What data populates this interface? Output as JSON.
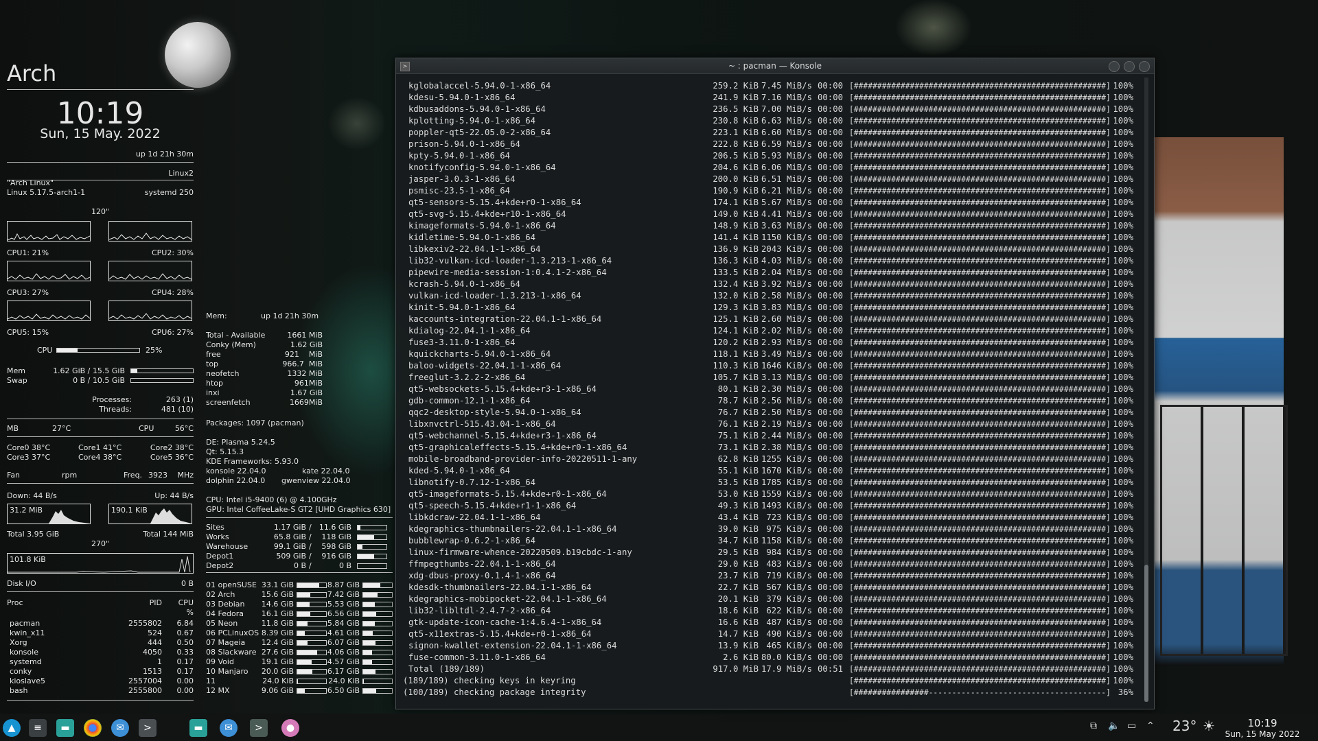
{
  "conky": {
    "title": "Arch",
    "time": "10:19",
    "date": "Sun, 15 May. 2022",
    "uptime": "up  1d 21h 30m",
    "kernel_name": "Linux2",
    "os": "\"Arch Linux\"",
    "kernel": "Linux 5.17.5-arch1-1",
    "systemd": "systemd 250",
    "graph_interval": "120\"",
    "cpus": [
      "CPU1: 21%",
      "CPU2: 30%",
      "CPU3: 27%",
      "CPU4: 28%",
      "CPU5: 15%",
      "CPU6: 27%"
    ],
    "cpu_label": "CPU",
    "cpu_total": "25%",
    "cpu_total_frac": 0.25,
    "mem_label": "Mem",
    "mem_value": "1.62 GiB / 15.5 GiB",
    "mem_frac": 0.1,
    "swap_label": "Swap",
    "swap_value": "0 B / 10.5 GiB",
    "swap_frac": 0,
    "processes_label": "Processes:",
    "processes_value": "263 (1)",
    "threads_label": "Threads:",
    "threads_value": "481 (10)",
    "mb_label": "MB",
    "mb_temp": "27°C",
    "cpu_temp_label": "CPU",
    "cpu_temp": "56°C",
    "cores": [
      "Core0  38°C",
      "Core1  41°C",
      "Core2  38°C",
      "Core3  37°C",
      "Core4  38°C",
      "Core5  36°C"
    ],
    "fan_label": "Fan",
    "fan_unit": "rpm",
    "freq_label": "Freq.",
    "freq_value": "3923",
    "freq_unit": "MHz",
    "down": "Down: 44 B/s",
    "up": "Up: 44 B/s",
    "down_graph": "31.2 MiB",
    "up_graph": "190.1 KiB",
    "total_down": "Total 3.95 GiB",
    "total_up": "Total 144 MiB",
    "graph_interval2": "270\"",
    "disk_graph": "101.8 KiB",
    "disk_io_label": "Disk I/O",
    "disk_io_value": "0 B",
    "proc_header": {
      "name": "Proc",
      "pid": "PID",
      "cpu": "CPU",
      "unit": "%"
    },
    "procs": [
      {
        "name": "pacman",
        "pid": "2555802",
        "cpu": "6.84"
      },
      {
        "name": "kwin_x11",
        "pid": "524",
        "cpu": "0.67"
      },
      {
        "name": "Xorg",
        "pid": "444",
        "cpu": "0.50"
      },
      {
        "name": "konsole",
        "pid": "4050",
        "cpu": "0.33"
      },
      {
        "name": "systemd",
        "pid": "1",
        "cpu": "0.17"
      },
      {
        "name": "conky",
        "pid": "1513",
        "cpu": "0.17"
      },
      {
        "name": "kioslave5",
        "pid": "2557004",
        "cpu": "0.00"
      },
      {
        "name": "bash",
        "pid": "2555800",
        "cpu": "0.00"
      }
    ]
  },
  "conky2": {
    "mem_header": "Mem:",
    "uptime": "up  1d 21h 30m",
    "mem_rows": [
      {
        "k": "Total - Available",
        "v": "1661 MiB"
      },
      {
        "k": "Conky (Mem)",
        "v": "1.62 GiB"
      },
      {
        "k": "free",
        "v": "921    MiB"
      },
      {
        "k": "top",
        "v": "966.7  MiB"
      },
      {
        "k": "neofetch",
        "v": "1332 MiB"
      },
      {
        "k": "htop",
        "v": "961MiB"
      },
      {
        "k": "inxi",
        "v": "1.67 GiB"
      },
      {
        "k": "screenfetch",
        "v": "1669MiB"
      }
    ],
    "packages": "Packages: 1097 (pacman)",
    "de": "DE: Plasma 5.24.5",
    "qt": "Qt: 5.15.3",
    "kf": "KDE Frameworks: 5.93.0",
    "konsole": "konsole 22.04.0",
    "kate": "kate 22.04.0",
    "dolphin": "dolphin 22.04.0",
    "gwenview": "gwenview 22.04.0",
    "cpu": "CPU: Intel i5-9400 (6) @ 4.100GHz",
    "gpu": "GPU: Intel CoffeeLake-S GT2 [UHD Graphics 630]",
    "mounts": [
      {
        "name": "Sites",
        "used": "1.17 GiB",
        "size": "11.6 GiB",
        "frac": 0.1
      },
      {
        "name": "Works",
        "used": "65.8 GiB",
        "size": "118 GiB",
        "frac": 0.56
      },
      {
        "name": "Warehouse",
        "used": "99.1 GiB",
        "size": "598 GiB",
        "frac": 0.17
      },
      {
        "name": "Depot1",
        "used": "509 GiB",
        "size": "916 GiB",
        "frac": 0.56
      },
      {
        "name": "Depot2",
        "used": "0 B",
        "size": "0 B",
        "frac": 0
      }
    ],
    "distros": [
      {
        "name": "01 openSUSE",
        "a": "33.1 GiB",
        "af": 0.75,
        "b": "8.87 GiB",
        "bf": 0.6
      },
      {
        "name": "02 Arch",
        "a": "15.6 GiB",
        "af": 0.45,
        "b": "7.42 GiB",
        "bf": 0.5
      },
      {
        "name": "03 Debian",
        "a": "14.6 GiB",
        "af": 0.42,
        "b": "5.53 GiB",
        "bf": 0.4
      },
      {
        "name": "04 Fedora",
        "a": "16.1 GiB",
        "af": 0.46,
        "b": "6.56 GiB",
        "bf": 0.45
      },
      {
        "name": "05 Neon",
        "a": "11.8 GiB",
        "af": 0.35,
        "b": "5.84 GiB",
        "bf": 0.4
      },
      {
        "name": "06 PCLinuxOS",
        "a": "8.39 GiB",
        "af": 0.25,
        "b": "4.61 GiB",
        "bf": 0.33
      },
      {
        "name": "07 Mageia",
        "a": "12.4 GiB",
        "af": 0.36,
        "b": "6.07 GiB",
        "bf": 0.42
      },
      {
        "name": "08 Slackware",
        "a": "27.6 GiB",
        "af": 0.7,
        "b": "4.06 GiB",
        "bf": 0.3
      },
      {
        "name": "09 Void",
        "a": "19.1 GiB",
        "af": 0.5,
        "b": "4.57 GiB",
        "bf": 0.32
      },
      {
        "name": "10 Manjaro",
        "a": "20.0 GiB",
        "af": 0.52,
        "b": "6.17 GiB",
        "bf": 0.43
      },
      {
        "name": "11",
        "a": "24.0 KiB",
        "af": 0.02,
        "b": "24.0 KiB",
        "bf": 0.02
      },
      {
        "name": "12 MX",
        "a": "9.06 GiB",
        "af": 0.27,
        "b": "6.50 GiB",
        "bf": 0.45
      }
    ]
  },
  "konsole": {
    "title": "~ : pacman — Konsole",
    "rows": [
      [
        "kglobalaccel-5.94.0-1-x86_64",
        "259.2 KiB",
        "7.45 MiB/s",
        "00:00",
        "[######################################################]",
        "100%"
      ],
      [
        "kdesu-5.94.0-1-x86_64",
        "241.9 KiB",
        "7.16 MiB/s",
        "00:00",
        "[######################################################]",
        "100%"
      ],
      [
        "kdbusaddons-5.94.0-1-x86_64",
        "236.5 KiB",
        "7.00 MiB/s",
        "00:00",
        "[######################################################]",
        "100%"
      ],
      [
        "kplotting-5.94.0-1-x86_64",
        "230.8 KiB",
        "6.63 MiB/s",
        "00:00",
        "[######################################################]",
        "100%"
      ],
      [
        "poppler-qt5-22.05.0-2-x86_64",
        "223.1 KiB",
        "6.60 MiB/s",
        "00:00",
        "[######################################################]",
        "100%"
      ],
      [
        "prison-5.94.0-1-x86_64",
        "222.8 KiB",
        "6.59 MiB/s",
        "00:00",
        "[######################################################]",
        "100%"
      ],
      [
        "kpty-5.94.0-1-x86_64",
        "206.5 KiB",
        "5.93 MiB/s",
        "00:00",
        "[######################################################]",
        "100%"
      ],
      [
        "knotifyconfig-5.94.0-1-x86_64",
        "204.6 KiB",
        "6.06 MiB/s",
        "00:00",
        "[######################################################]",
        "100%"
      ],
      [
        "jasper-3.0.3-1-x86_64",
        "200.0 KiB",
        "6.51 MiB/s",
        "00:00",
        "[######################################################]",
        "100%"
      ],
      [
        "psmisc-23.5-1-x86_64",
        "190.9 KiB",
        "6.21 MiB/s",
        "00:00",
        "[######################################################]",
        "100%"
      ],
      [
        "qt5-sensors-5.15.4+kde+r0-1-x86_64",
        "174.1 KiB",
        "5.67 MiB/s",
        "00:00",
        "[######################################################]",
        "100%"
      ],
      [
        "qt5-svg-5.15.4+kde+r10-1-x86_64",
        "149.0 KiB",
        "4.41 MiB/s",
        "00:00",
        "[######################################################]",
        "100%"
      ],
      [
        "kimageformats-5.94.0-1-x86_64",
        "148.9 KiB",
        "3.63 MiB/s",
        "00:00",
        "[######################################################]",
        "100%"
      ],
      [
        "kidletime-5.94.0-1-x86_64",
        "141.4 KiB",
        "1150 KiB/s",
        "00:00",
        "[######################################################]",
        "100%"
      ],
      [
        "libkexiv2-22.04.1-1-x86_64",
        "136.9 KiB",
        "2043 KiB/s",
        "00:00",
        "[######################################################]",
        "100%"
      ],
      [
        "lib32-vulkan-icd-loader-1.3.213-1-x86_64",
        "136.3 KiB",
        "4.03 MiB/s",
        "00:00",
        "[######################################################]",
        "100%"
      ],
      [
        "pipewire-media-session-1:0.4.1-2-x86_64",
        "133.5 KiB",
        "2.04 MiB/s",
        "00:00",
        "[######################################################]",
        "100%"
      ],
      [
        "kcrash-5.94.0-1-x86_64",
        "132.4 KiB",
        "3.92 MiB/s",
        "00:00",
        "[######################################################]",
        "100%"
      ],
      [
        "vulkan-icd-loader-1.3.213-1-x86_64",
        "132.0 KiB",
        "2.58 MiB/s",
        "00:00",
        "[######################################################]",
        "100%"
      ],
      [
        "kinit-5.94.0-1-x86_64",
        "129.3 KiB",
        "3.83 MiB/s",
        "00:00",
        "[######################################################]",
        "100%"
      ],
      [
        "kaccounts-integration-22.04.1-1-x86_64",
        "125.1 KiB",
        "2.60 MiB/s",
        "00:00",
        "[######################################################]",
        "100%"
      ],
      [
        "kdialog-22.04.1-1-x86_64",
        "124.1 KiB",
        "2.02 MiB/s",
        "00:00",
        "[######################################################]",
        "100%"
      ],
      [
        "fuse3-3.11.0-1-x86_64",
        "120.2 KiB",
        "2.93 MiB/s",
        "00:00",
        "[######################################################]",
        "100%"
      ],
      [
        "kquickcharts-5.94.0-1-x86_64",
        "118.1 KiB",
        "3.49 MiB/s",
        "00:00",
        "[######################################################]",
        "100%"
      ],
      [
        "baloo-widgets-22.04.1-1-x86_64",
        "110.3 KiB",
        "1646 KiB/s",
        "00:00",
        "[######################################################]",
        "100%"
      ],
      [
        "freeglut-3.2.2-2-x86_64",
        "105.7 KiB",
        "3.13 MiB/s",
        "00:00",
        "[######################################################]",
        "100%"
      ],
      [
        "qt5-websockets-5.15.4+kde+r3-1-x86_64",
        "80.1 KiB",
        "2.30 MiB/s",
        "00:00",
        "[######################################################]",
        "100%"
      ],
      [
        "gdb-common-12.1-1-x86_64",
        "78.7 KiB",
        "2.56 MiB/s",
        "00:00",
        "[######################################################]",
        "100%"
      ],
      [
        "qqc2-desktop-style-5.94.0-1-x86_64",
        "76.7 KiB",
        "2.50 MiB/s",
        "00:00",
        "[######################################################]",
        "100%"
      ],
      [
        "libxnvctrl-515.43.04-1-x86_64",
        "76.1 KiB",
        "2.19 MiB/s",
        "00:00",
        "[######################################################]",
        "100%"
      ],
      [
        "qt5-webchannel-5.15.4+kde+r3-1-x86_64",
        "75.1 KiB",
        "2.44 MiB/s",
        "00:00",
        "[######################################################]",
        "100%"
      ],
      [
        "qt5-graphicaleffects-5.15.4+kde+r0-1-x86_64",
        "73.1 KiB",
        "2.38 MiB/s",
        "00:00",
        "[######################################################]",
        "100%"
      ],
      [
        "mobile-broadband-provider-info-20220511-1-any",
        "62.8 KiB",
        "1255 KiB/s",
        "00:00",
        "[######################################################]",
        "100%"
      ],
      [
        "kded-5.94.0-1-x86_64",
        "55.1 KiB",
        "1670 KiB/s",
        "00:00",
        "[######################################################]",
        "100%"
      ],
      [
        "libnotify-0.7.12-1-x86_64",
        "53.5 KiB",
        "1785 KiB/s",
        "00:00",
        "[######################################################]",
        "100%"
      ],
      [
        "qt5-imageformats-5.15.4+kde+r0-1-x86_64",
        "53.0 KiB",
        "1559 KiB/s",
        "00:00",
        "[######################################################]",
        "100%"
      ],
      [
        "qt5-speech-5.15.4+kde+r1-1-x86_64",
        "49.3 KiB",
        "1493 KiB/s",
        "00:00",
        "[######################################################]",
        "100%"
      ],
      [
        "libkdcraw-22.04.1-1-x86_64",
        "43.4 KiB",
        "723 KiB/s",
        "00:00",
        "[######################################################]",
        "100%"
      ],
      [
        "kdegraphics-thumbnailers-22.04.1-1-x86_64",
        "39.0 KiB",
        "975 KiB/s",
        "00:00",
        "[######################################################]",
        "100%"
      ],
      [
        "bubblewrap-0.6.2-1-x86_64",
        "34.7 KiB",
        "1158 KiB/s",
        "00:00",
        "[######################################################]",
        "100%"
      ],
      [
        "linux-firmware-whence-20220509.b19cbdc-1-any",
        "29.5 KiB",
        "984 KiB/s",
        "00:00",
        "[######################################################]",
        "100%"
      ],
      [
        "ffmpegthumbs-22.04.1-1-x86_64",
        "29.0 KiB",
        "483 KiB/s",
        "00:00",
        "[######################################################]",
        "100%"
      ],
      [
        "xdg-dbus-proxy-0.1.4-1-x86_64",
        "23.7 KiB",
        "719 KiB/s",
        "00:00",
        "[######################################################]",
        "100%"
      ],
      [
        "kdesdk-thumbnailers-22.04.1-1-x86_64",
        "22.7 KiB",
        "567 KiB/s",
        "00:00",
        "[######################################################]",
        "100%"
      ],
      [
        "kdegraphics-mobipocket-22.04.1-1-x86_64",
        "20.1 KiB",
        "379 KiB/s",
        "00:00",
        "[######################################################]",
        "100%"
      ],
      [
        "lib32-libltdl-2.4.7-2-x86_64",
        "18.6 KiB",
        "622 KiB/s",
        "00:00",
        "[######################################################]",
        "100%"
      ],
      [
        "gtk-update-icon-cache-1:4.6.4-1-x86_64",
        "16.6 KiB",
        "487 KiB/s",
        "00:00",
        "[######################################################]",
        "100%"
      ],
      [
        "qt5-x11extras-5.15.4+kde+r0-1-x86_64",
        "14.7 KiB",
        "490 KiB/s",
        "00:00",
        "[######################################################]",
        "100%"
      ],
      [
        "signon-kwallet-extension-22.04.1-1-x86_64",
        "13.9 KiB",
        "465 KiB/s",
        "00:00",
        "[######################################################]",
        "100%"
      ],
      [
        "fuse-common-3.11.0-1-x86_64",
        "2.6 KiB",
        "80.0 KiB/s",
        "00:00",
        "[######################################################]",
        "100%"
      ],
      [
        "Total (189/189)",
        "917.0 MiB",
        "17.9 MiB/s",
        "00:51",
        "[######################################################]",
        "100%"
      ]
    ],
    "check1": "(189/189) checking keys in keyring",
    "check1_bar": "[######################################################]",
    "check1_pct": "100%",
    "check2": "(100/189) checking package integrity",
    "check2_bar": "[################--------------------------------------]",
    "check2_pct": "36%"
  },
  "taskbar": {
    "temperature": "23°",
    "clock_time": "10:19",
    "clock_date": "Sun, 15 May 2022"
  }
}
